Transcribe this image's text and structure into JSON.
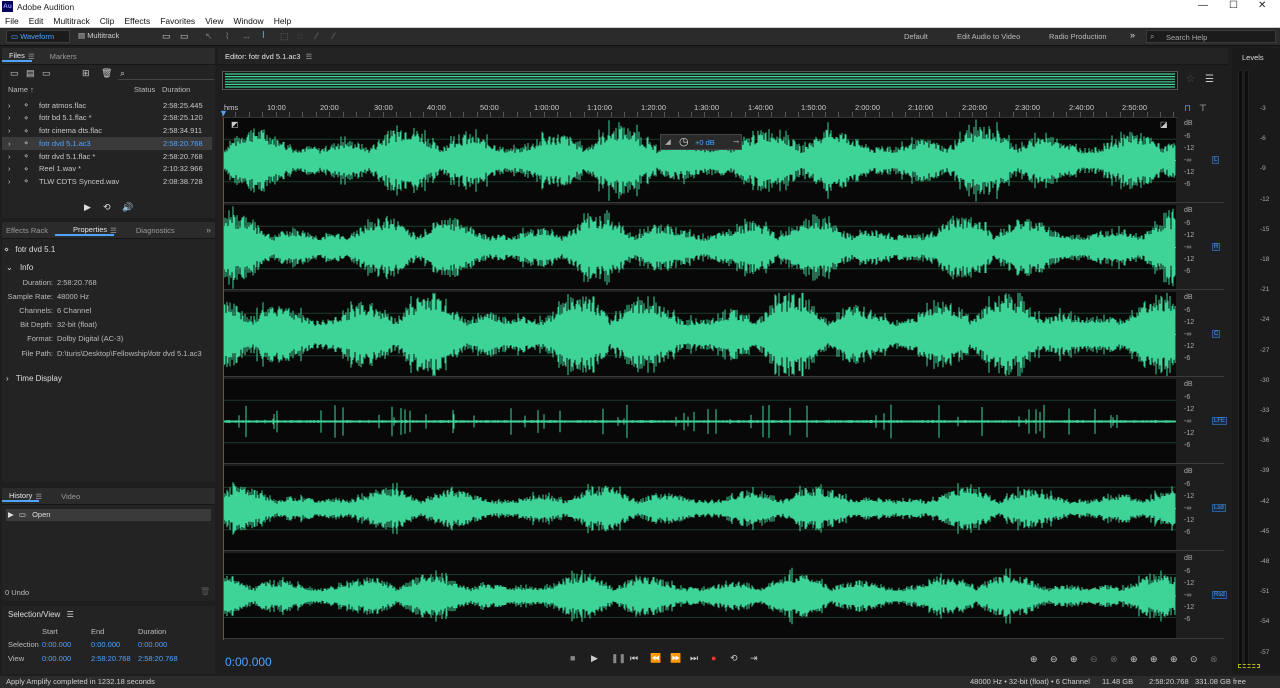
{
  "app": {
    "title": "Adobe Audition",
    "logo": "Au"
  },
  "menu": [
    "File",
    "Edit",
    "Multitrack",
    "Clip",
    "Effects",
    "Favorites",
    "View",
    "Window",
    "Help"
  ],
  "toolbar": {
    "waveform": "Waveform",
    "multitrack": "Multitrack",
    "workspaces": [
      "Default",
      "Edit Audio to Video",
      "Radio Production"
    ],
    "search_placeholder": "Search Help"
  },
  "files_panel": {
    "tabs": [
      "Files",
      "Markers"
    ],
    "columns": [
      "Name ↑",
      "Status",
      "Duration"
    ],
    "items": [
      {
        "name": "fotr atmos.flac",
        "duration": "2:58:25.445"
      },
      {
        "name": "fotr bd 5.1.flac *",
        "duration": "2:58:25.120"
      },
      {
        "name": "fotr cinema dts.flac",
        "duration": "2:58:34.911"
      },
      {
        "name": "fotr dvd 5.1.ac3",
        "duration": "2:58:20.768"
      },
      {
        "name": "fotr dvd 5.1.flac *",
        "duration": "2:58:20.768"
      },
      {
        "name": "Reel 1.wav *",
        "duration": "2:10:32.966"
      },
      {
        "name": "TLW CDTS Synced.wav",
        "duration": "2:08:38.728"
      }
    ]
  },
  "properties": {
    "tabs": [
      "Effects Rack",
      "Properties",
      "Diagnostics"
    ],
    "file_name": "fotr dvd 5.1",
    "info_label": "Info",
    "info": [
      {
        "k": "Duration:",
        "v": "2:58:20.768"
      },
      {
        "k": "Sample Rate:",
        "v": "48000 Hz"
      },
      {
        "k": "Channels:",
        "v": "6 Channel"
      },
      {
        "k": "Bit Depth:",
        "v": "32-bit (float)"
      },
      {
        "k": "Format:",
        "v": "Dolby Digital (AC-3)"
      },
      {
        "k": "File Path:",
        "v": "D:\\turis\\Desktop\\Fellowship\\fotr dvd 5.1.ac3"
      }
    ],
    "time_display": "Time Display"
  },
  "history": {
    "tabs": [
      "History",
      "Video"
    ],
    "item": "Open",
    "undo": "0 Undo"
  },
  "selection": {
    "title": "Selection/View",
    "headers": [
      "Start",
      "End",
      "Duration"
    ],
    "rows": [
      {
        "label": "Selection",
        "start": "0:00.000",
        "end": "0:00.000",
        "duration": "0:00.000"
      },
      {
        "label": "View",
        "start": "0:00.000",
        "end": "2:58:20.768",
        "duration": "2:58:20.768"
      }
    ]
  },
  "editor": {
    "title": "Editor: fotr dvd 5.1.ac3",
    "ruler_unit": "hms",
    "ruler": [
      "10:00",
      "20:00",
      "30:00",
      "40:00",
      "50:00",
      "1:00:00",
      "1:10:00",
      "1:20:00",
      "1:30:00",
      "1:40:00",
      "1:50:00",
      "2:00:00",
      "2:10:00",
      "2:20:00",
      "2:30:00",
      "2:40:00",
      "2:50:00"
    ],
    "hud_db": "+0 dB",
    "channels": [
      "L",
      "R",
      "C",
      "LFE",
      "Lsd",
      "Rsd"
    ],
    "db_scale": [
      "dB",
      "-6",
      "-12",
      "-∞",
      "-12",
      "-6"
    ],
    "time": "0:00.000",
    "wave_color": "#3ed497"
  },
  "levels": {
    "title": "Levels",
    "scale": [
      "-3",
      "-6",
      "-9",
      "-12",
      "-15",
      "-18",
      "-21",
      "-24",
      "-27",
      "-30",
      "-33",
      "-36",
      "-39",
      "-42",
      "-45",
      "-48",
      "-51",
      "-54",
      "-57"
    ]
  },
  "status": {
    "left": "Apply Amplify completed in 1232.18 seconds",
    "right": [
      "48000 Hz • 32-bit (float) • 6 Channel",
      "11.48 GB",
      "2:58:20.768",
      "331.08 GB free"
    ]
  }
}
